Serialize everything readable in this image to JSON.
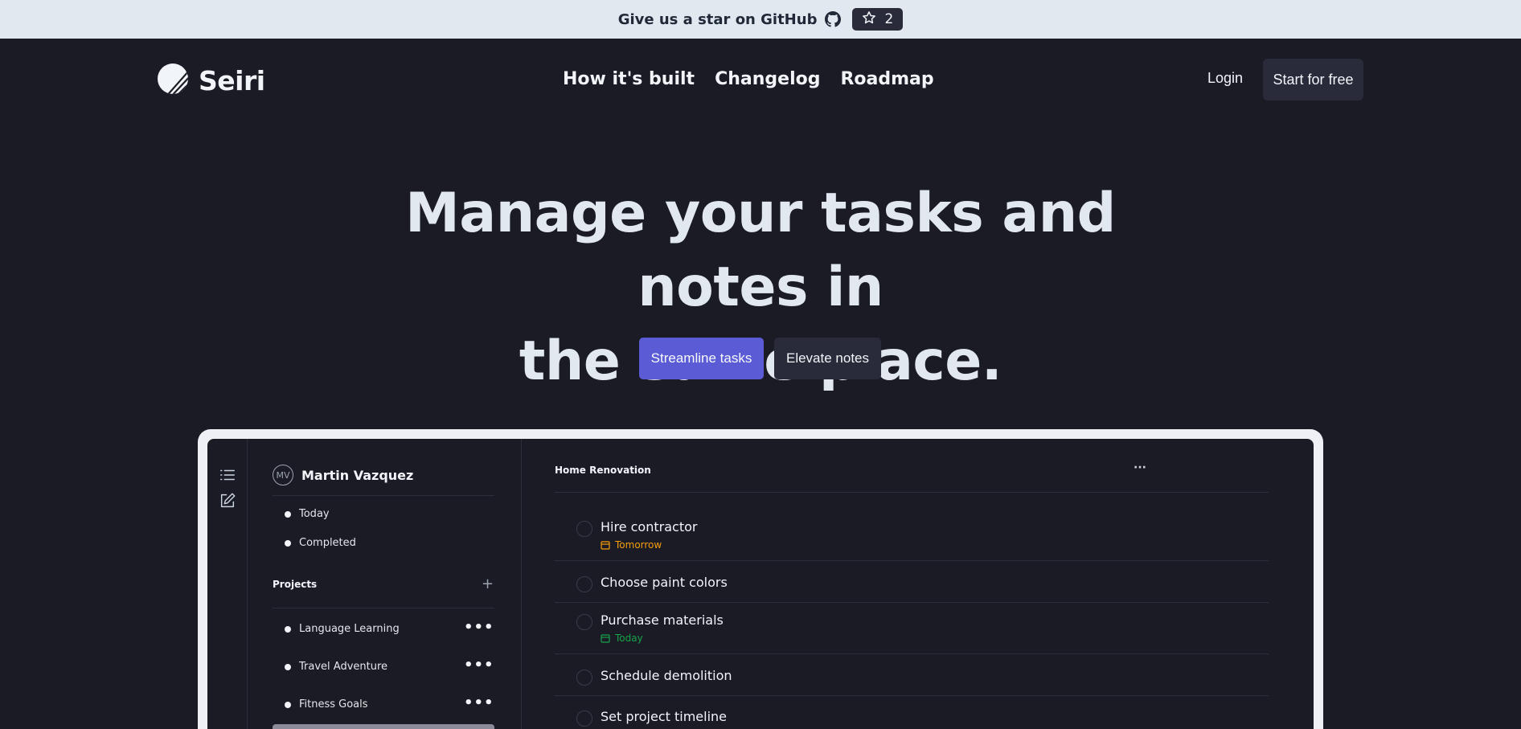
{
  "banner": {
    "text": "Give us a star on GitHub",
    "star_count": "2"
  },
  "nav": {
    "logo": "Seiri",
    "links": [
      "How it's built",
      "Changelog",
      "Roadmap"
    ],
    "login": "Login",
    "cta": "Start for free"
  },
  "hero": {
    "title_line1": "Manage your tasks and notes in",
    "title_line2": "the same place.",
    "primary_btn": "Streamline tasks",
    "secondary_btn": "Elevate notes"
  },
  "app": {
    "user": {
      "initials": "MV",
      "name": "Martin Vazquez"
    },
    "filters": [
      "Today",
      "Completed"
    ],
    "projects_label": "Projects",
    "projects": [
      "Language Learning",
      "Travel Adventure",
      "Fitness Goals"
    ],
    "project_title": "Home Renovation",
    "tasks": [
      {
        "title": "Hire contractor",
        "due": "Tomorrow",
        "due_color": "#f59e0b"
      },
      {
        "title": "Choose paint colors",
        "due": ""
      },
      {
        "title": "Purchase materials",
        "due": "Today",
        "due_color": "#16a34a"
      },
      {
        "title": "Schedule demolition",
        "due": ""
      },
      {
        "title": "Set project timeline",
        "due": ""
      }
    ]
  },
  "colors": {
    "primary": "#5b5bd6",
    "background": "#1b1b25",
    "banner": "#e2e8f0"
  }
}
